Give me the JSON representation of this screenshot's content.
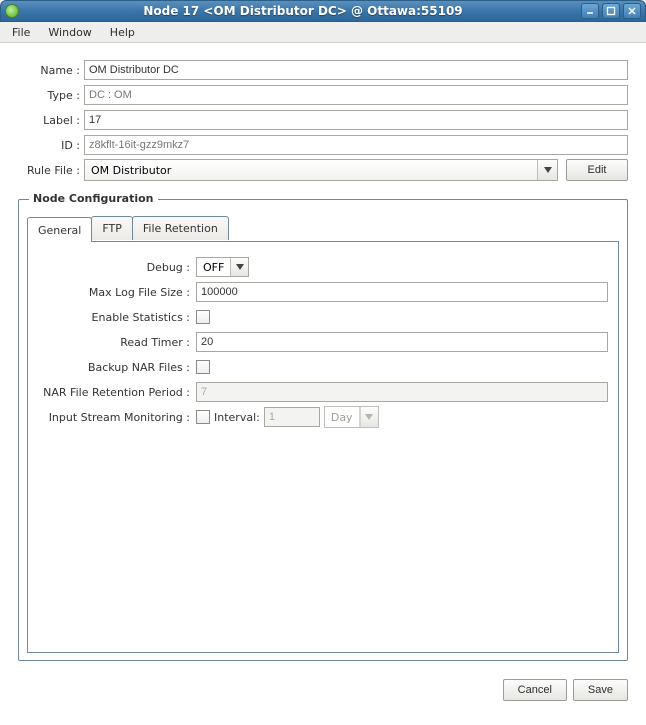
{
  "window": {
    "title": "Node 17 <OM Distributor DC> @ Ottawa:55109"
  },
  "menu": {
    "file": "File",
    "window": "Window",
    "help": "Help"
  },
  "labels": {
    "name": "Name :",
    "type": "Type :",
    "label": "Label :",
    "id": "ID :",
    "ruleFile": "Rule File :"
  },
  "fields": {
    "name": "OM Distributor DC",
    "type": "DC : OM",
    "label": "17",
    "id": "z8kflt-16it-gzz9mkz7",
    "ruleFile": "OM Distributor"
  },
  "buttons": {
    "edit": "Edit",
    "cancel": "Cancel",
    "save": "Save"
  },
  "fieldset": {
    "title": "Node Configuration"
  },
  "tabs": {
    "general": "General",
    "ftp": "FTP",
    "fileRetention": "File Retention"
  },
  "cfgLabels": {
    "debug": "Debug :",
    "maxLog": "Max Log File Size :",
    "enableStats": "Enable Statistics :",
    "readTimer": "Read Timer :",
    "backupNar": "Backup NAR Files :",
    "narRetention": "NAR File Retention Period :",
    "inputStream": "Input Stream Monitoring :",
    "interval": "Interval:"
  },
  "cfgValues": {
    "debug": "OFF",
    "maxLog": "100000",
    "readTimer": "20",
    "narRetention": "7",
    "intervalNum": "1",
    "intervalUnit": "Day"
  }
}
